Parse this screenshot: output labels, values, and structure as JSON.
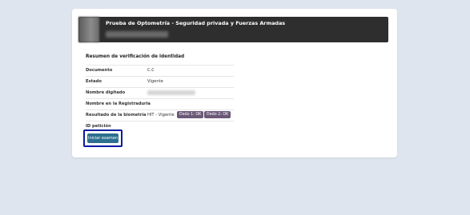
{
  "header": {
    "title": "Prueba de Optometría - Seguridad privada y Fuerzas Armadas"
  },
  "summary": {
    "title": "Resumen de verificación de identidad",
    "rows": [
      {
        "label": "Documento",
        "value": "C.C"
      },
      {
        "label": "Estado",
        "value": "Vigente"
      },
      {
        "label": "Nombre digitado",
        "value": ""
      },
      {
        "label": "Nombre en la Registraduria",
        "value": ""
      },
      {
        "label": "Resultado de la biometría",
        "value": "HIT - Vigente"
      },
      {
        "label": "ID petición",
        "value": ""
      }
    ],
    "chips": [
      "Dedo 1: OK",
      "Dedo 2: OK"
    ]
  },
  "actions": {
    "start_label": "Iniciar examen"
  },
  "colors": {
    "page_bg": "#dfe5ee",
    "header_bg": "#2e2e2e",
    "chip_bg": "#6b5877",
    "button_bg": "#2c6f8f",
    "focus_ring": "#0b1aa0"
  }
}
